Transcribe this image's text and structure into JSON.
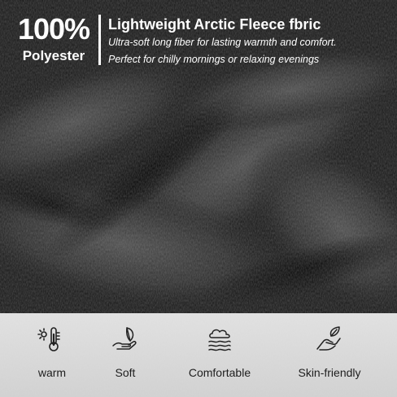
{
  "header": {
    "badge_percent": "100%",
    "badge_material": "Polyester",
    "title": "Lightweight Arctic Fleece fbric",
    "line1": "Ultra-soft long fiber for lasting warmth and comfort.",
    "line2": "Perfect for chilly mornings or relaxing evenings"
  },
  "features": [
    {
      "label": "warm",
      "icon": "thermometer-sun-icon"
    },
    {
      "label": "Soft",
      "icon": "feather-hand-icon"
    },
    {
      "label": "Comfortable",
      "icon": "cloud-waves-icon"
    },
    {
      "label": "Skin-friendly",
      "icon": "hand-leaf-icon"
    }
  ],
  "colors": {
    "fabric": "#1a1a1a",
    "text_light": "#ffffff",
    "panel": "#e6e6e6",
    "text_dark": "#1e1e1e"
  }
}
